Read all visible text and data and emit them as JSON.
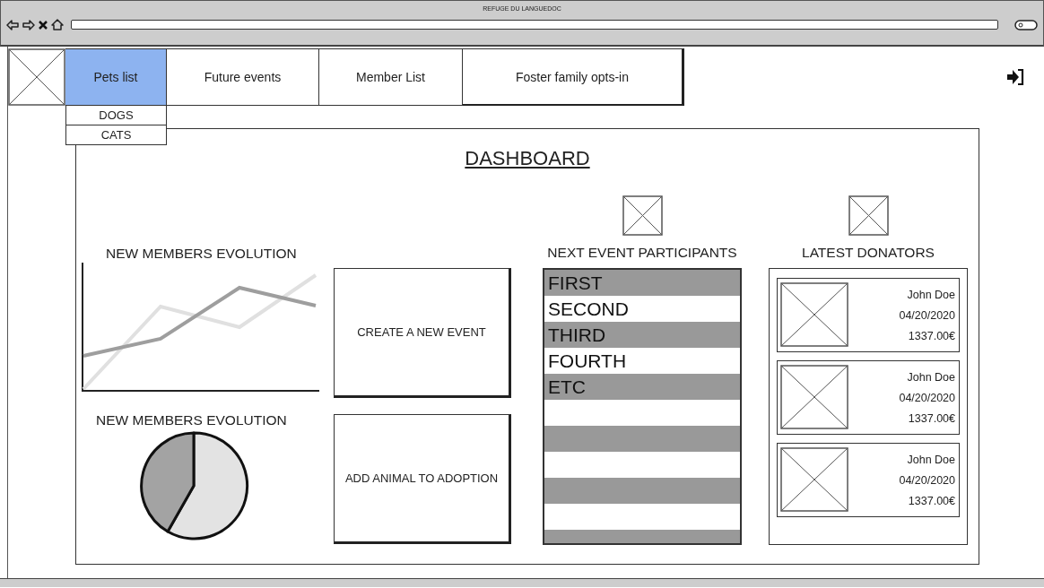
{
  "browser": {
    "title": "REFUGE DU LANGUEDOC"
  },
  "nav": {
    "tabs": [
      {
        "label": "Pets list",
        "selected": true,
        "menu": [
          "DOGS",
          "CATS"
        ]
      },
      {
        "label": "Future events",
        "selected": false
      },
      {
        "label": "Member List",
        "selected": false
      },
      {
        "label": "Foster family opts-in",
        "selected": false
      }
    ]
  },
  "dashboard": {
    "title": "DASHBOARD",
    "line_chart": {
      "title": "NEW MEMBERS EVOLUTION"
    },
    "pie_chart": {
      "title": "NEW MEMBERS EVOLUTION"
    },
    "actions": [
      "CREATE A NEW EVENT",
      "ADD ANIMAL TO ADOPTION"
    ],
    "participants": {
      "title": "NEXT EVENT PARTICIPANTS",
      "items": [
        "FIRST",
        "SECOND",
        "THIRD",
        "FOURTH",
        "ETC"
      ]
    },
    "donators": {
      "title": "LATEST DONATORS",
      "items": [
        {
          "name": "John Doe",
          "date": "04/20/2020",
          "amount": "1337.00€"
        },
        {
          "name": "John Doe",
          "date": "04/20/2020",
          "amount": "1337.00€"
        },
        {
          "name": "John Doe",
          "date": "04/20/2020",
          "amount": "1337.00€"
        }
      ]
    }
  }
}
